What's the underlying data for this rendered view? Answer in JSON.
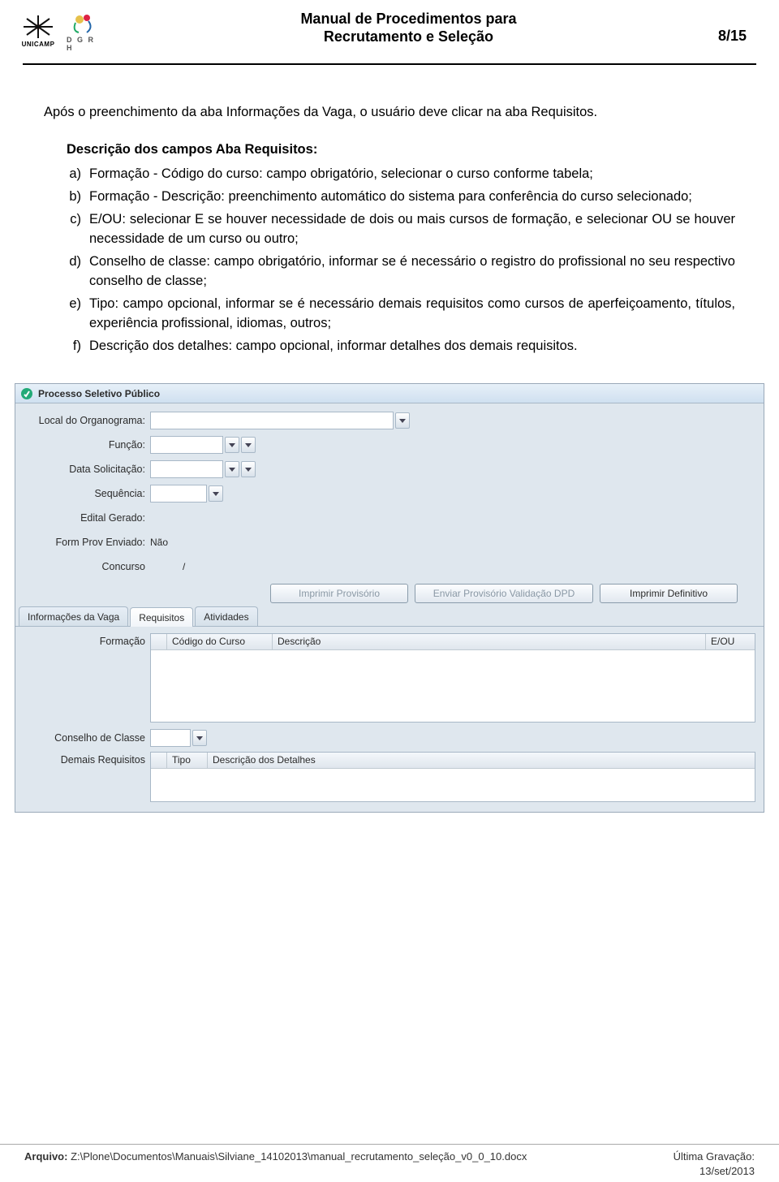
{
  "header": {
    "title_line1": "Manual de Procedimentos para",
    "title_line2": "Recrutamento e Seleção",
    "page": "8/15",
    "logo_unicamp": "UNICAMP",
    "logo_dgrh": "D G R H"
  },
  "content": {
    "intro": "Após o preenchimento da aba Informações da Vaga, o usuário deve clicar na aba Requisitos.",
    "section_title": "Descrição dos campos Aba Requisitos:",
    "items": [
      {
        "marker": "a)",
        "text": "Formação - Código do curso: campo obrigatório, selecionar o curso conforme tabela;"
      },
      {
        "marker": "b)",
        "text": "Formação - Descrição: preenchimento automático do sistema para conferência do curso selecionado;"
      },
      {
        "marker": "c)",
        "text": "E/OU: selecionar E se houver necessidade de dois ou mais cursos de formação, e selecionar OU se houver necessidade de um curso ou outro;"
      },
      {
        "marker": "d)",
        "text": "Conselho de classe: campo obrigatório, informar se é necessário o registro do profissional no seu respectivo conselho de classe;"
      },
      {
        "marker": "e)",
        "text": "Tipo: campo opcional, informar se é necessário demais requisitos como cursos de aperfeiçoamento, títulos, experiência profissional, idiomas, outros;"
      },
      {
        "marker": "f)",
        "text": "Descrição dos detalhes: campo opcional, informar detalhes dos demais requisitos."
      }
    ]
  },
  "app": {
    "title": "Processo Seletivo Público",
    "fields": {
      "local_organograma": {
        "label": "Local do Organograma:",
        "value": ""
      },
      "funcao": {
        "label": "Função:",
        "value": ""
      },
      "data_solicitacao": {
        "label": "Data Solicitação:",
        "value": ""
      },
      "sequencia": {
        "label": "Sequência:",
        "value": ""
      },
      "edital_gerado": {
        "label": "Edital Gerado:",
        "value": ""
      },
      "form_prov": {
        "label": "Form Prov Enviado:",
        "value": "Não"
      },
      "concurso": {
        "label": "Concurso",
        "value": "/"
      }
    },
    "buttons": {
      "imprimir_provisorio": "Imprimir Provisório",
      "enviar_validacao": "Enviar Provisório Validação DPD",
      "imprimir_definitivo": "Imprimir Definitivo"
    },
    "tabs": {
      "info_vaga": "Informações da Vaga",
      "requisitos": "Requisitos",
      "atividades": "Atividades"
    },
    "requisitos_tab": {
      "formacao_label": "Formação",
      "grid_headers": {
        "codigo": "Código do Curso",
        "descricao": "Descrição",
        "eou": "E/OU"
      },
      "conselho_label": "Conselho de Classe",
      "demais_label": "Demais Requisitos",
      "grid2_headers": {
        "tipo": "Tipo",
        "detalhes": "Descrição dos Detalhes"
      }
    }
  },
  "footer": {
    "arquivo_label": "Arquivo:",
    "arquivo_path": "Z:\\Plone\\Documentos\\Manuais\\Silviane_14102013\\manual_recrutamento_seleção_v0_0_10.docx",
    "gravacao_label": "Última Gravação:",
    "gravacao_value": "13/set/2013"
  }
}
